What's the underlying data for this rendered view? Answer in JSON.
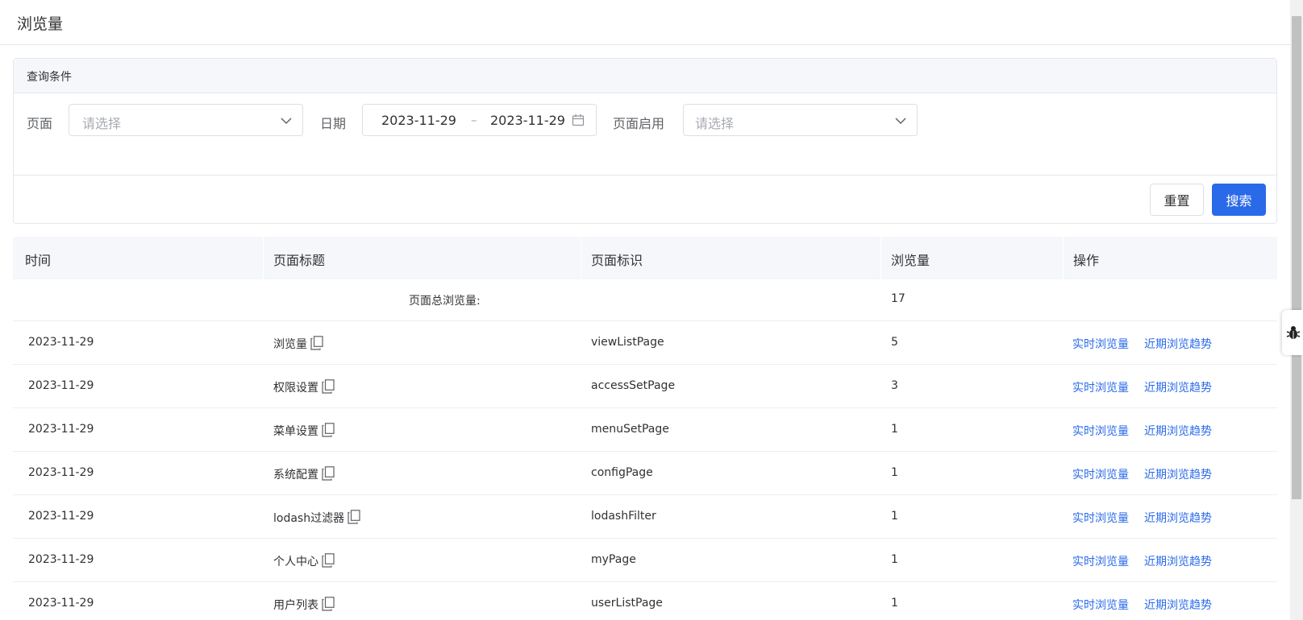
{
  "header": {
    "title": "浏览量"
  },
  "query": {
    "card_title": "查询条件",
    "page_label": "页面",
    "page_placeholder": "请选择",
    "date_label": "日期",
    "date_start": "2023-11-29",
    "date_separator": "–",
    "date_end": "2023-11-29",
    "enabled_label": "页面启用",
    "enabled_placeholder": "请选择",
    "reset_label": "重置",
    "search_label": "搜索"
  },
  "table": {
    "columns": [
      "时间",
      "页面标题",
      "页面标识",
      "浏览量",
      "操作"
    ],
    "summary": {
      "label": "页面总浏览量:",
      "total": "17"
    },
    "action_realtime": "实时浏览量",
    "action_trend": "近期浏览趋势",
    "rows": [
      {
        "time": "2023-11-29",
        "title": "浏览量",
        "key": "viewListPage",
        "views": "5"
      },
      {
        "time": "2023-11-29",
        "title": "权限设置",
        "key": "accessSetPage",
        "views": "3"
      },
      {
        "time": "2023-11-29",
        "title": "菜单设置",
        "key": "menuSetPage",
        "views": "1"
      },
      {
        "time": "2023-11-29",
        "title": "系统配置",
        "key": "configPage",
        "views": "1"
      },
      {
        "time": "2023-11-29",
        "title": "lodash过滤器",
        "key": "lodashFilter",
        "views": "1"
      },
      {
        "time": "2023-11-29",
        "title": "个人中心",
        "key": "myPage",
        "views": "1"
      },
      {
        "time": "2023-11-29",
        "title": "用户列表",
        "key": "userListPage",
        "views": "1"
      }
    ]
  },
  "icons": {
    "copy": "copy-icon",
    "calendar": "calendar-icon",
    "chevron": "chevron-down-icon",
    "bug": "bug-icon"
  },
  "colors": {
    "primary": "#2a6ae9",
    "header_bg": "#f5f7fa"
  }
}
